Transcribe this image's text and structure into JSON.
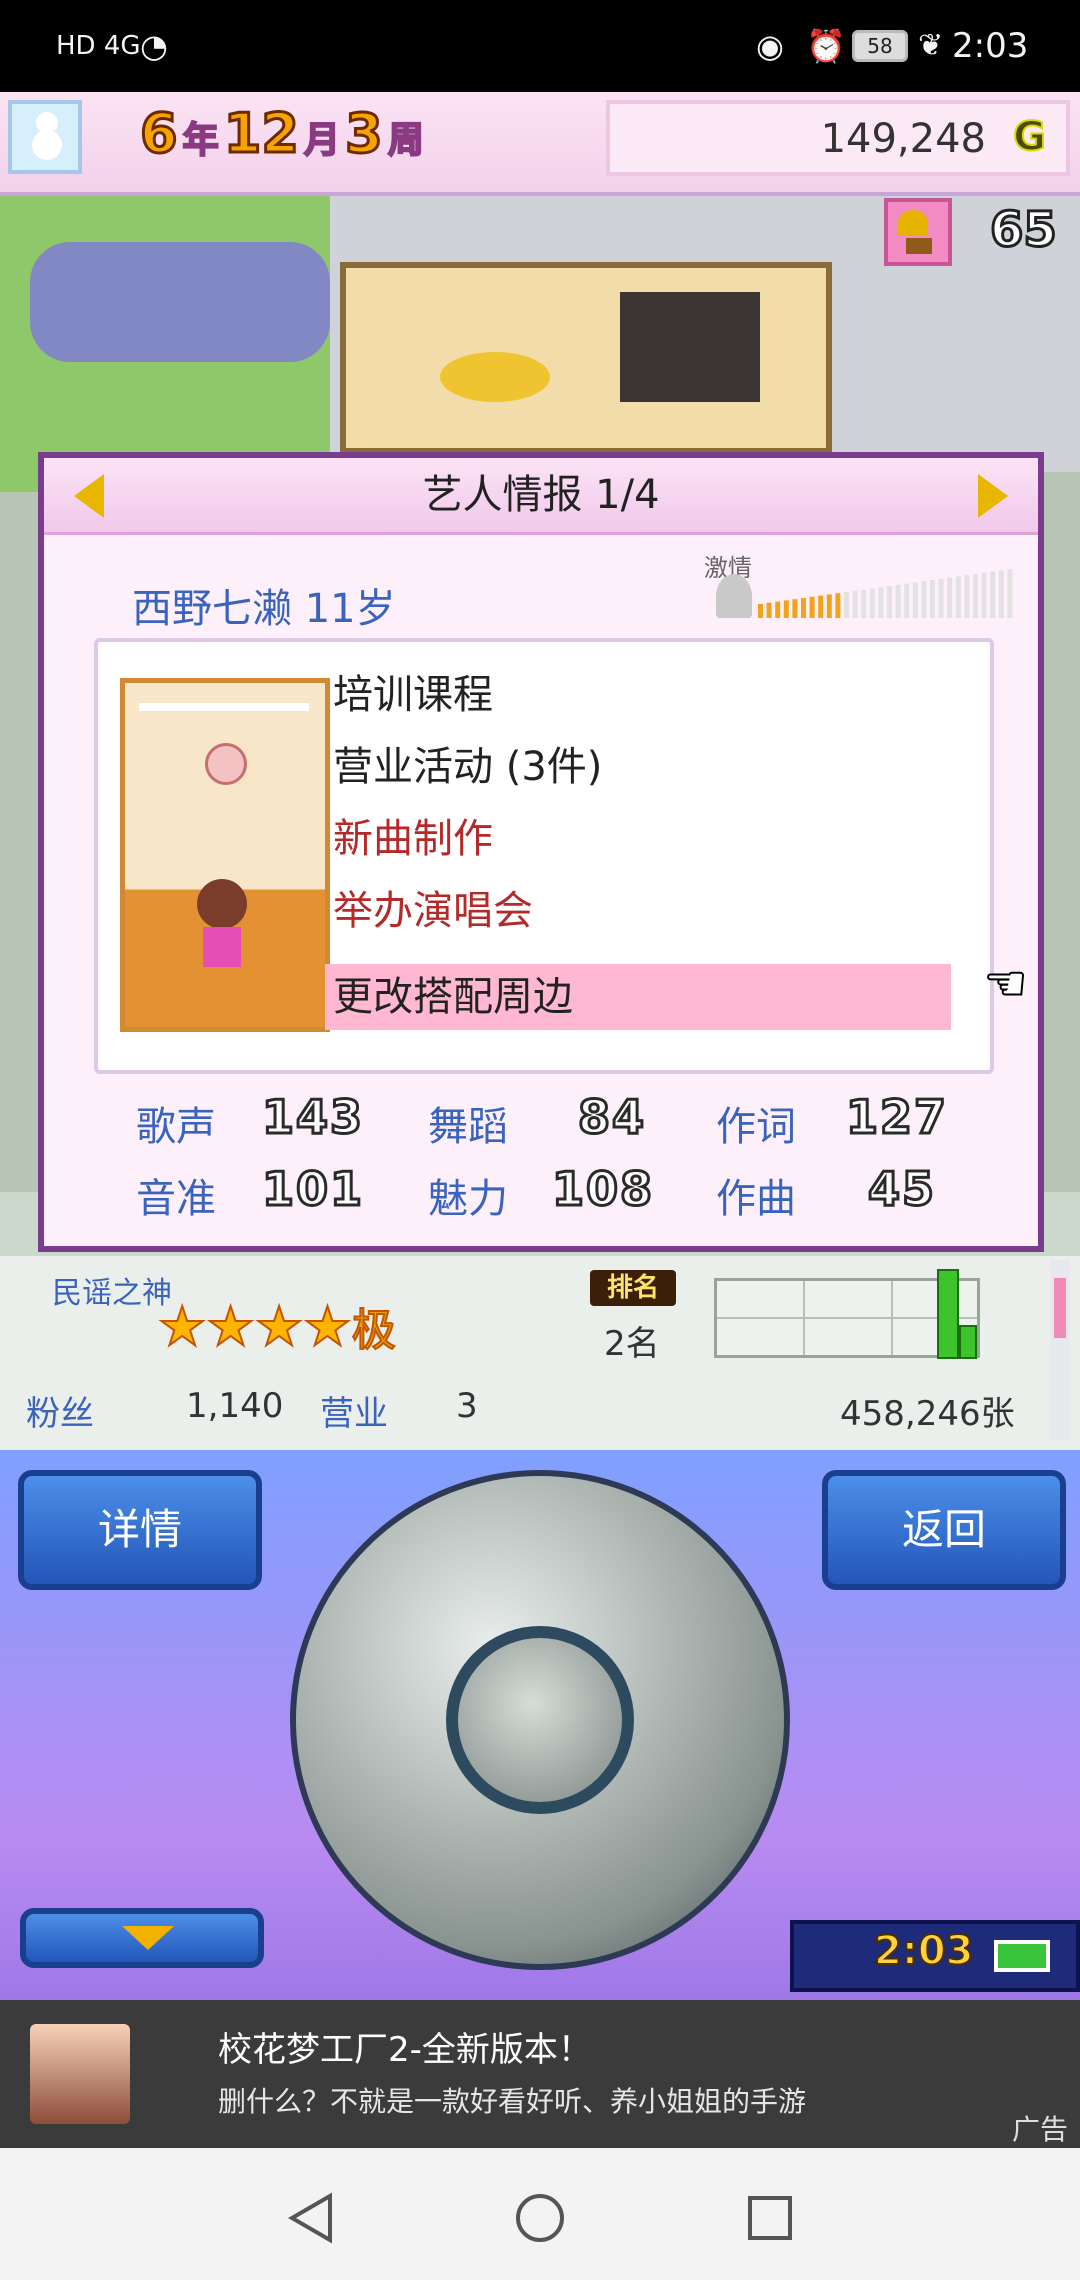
{
  "status_bar": {
    "left_icons": "HD 4G",
    "battery": "58",
    "time": "2:03"
  },
  "hud": {
    "year_num": "6",
    "year_unit": "年",
    "month_num": "12",
    "month_unit": "月",
    "week_num": "3",
    "week_unit": "周",
    "money": "149,248",
    "currency": "G",
    "trophy_count": "65"
  },
  "modal": {
    "title": "艺人情报 1/4",
    "idol_name_age": "西野七濑 11岁",
    "passion_label": "激情",
    "passion_level": 0.33,
    "menu": [
      {
        "label": "培训课程"
      },
      {
        "label": "营业活动 (3件)"
      },
      {
        "label": "新曲制作"
      },
      {
        "label": "举办演唱会"
      },
      {
        "label": "更改搭配周边"
      }
    ],
    "stats": [
      {
        "label": "歌声",
        "value": "143"
      },
      {
        "label": "舞蹈",
        "value": "84"
      },
      {
        "label": "作词",
        "value": "127"
      },
      {
        "label": "音准",
        "value": "101"
      },
      {
        "label": "魅力",
        "value": "108"
      },
      {
        "label": "作曲",
        "value": "45"
      }
    ]
  },
  "info": {
    "genre": "民谣之神",
    "star_extra": "极",
    "rank_badge": "排名",
    "rank": "2名",
    "fans_label": "粉丝",
    "fans_value": "1,140",
    "business_label": "营业",
    "business_value": "3",
    "sales": "458,246张"
  },
  "controller": {
    "detail_button": "详情",
    "back_button": "返回",
    "clock": "2:03"
  },
  "ad": {
    "title": "校花梦工厂2-全新版本！",
    "desc": "删什么？不就是一款好看好听、养小姐姐的手游",
    "tag": "广告"
  }
}
